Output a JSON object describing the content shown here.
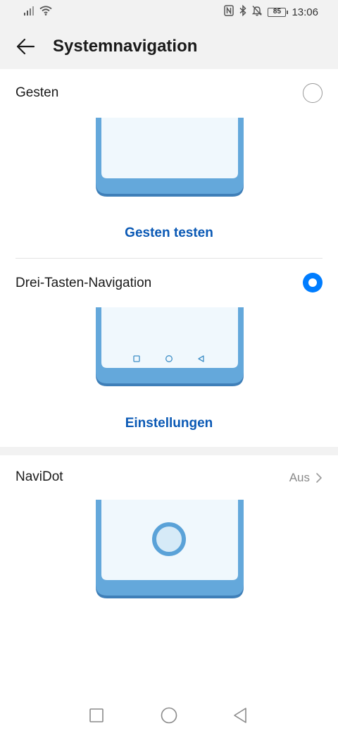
{
  "status_bar": {
    "time": "13:06",
    "battery_level": "85",
    "icons": [
      "signal-icon",
      "wifi-icon",
      "nfc-icon",
      "bluetooth-icon",
      "mute-bell-icon",
      "battery-icon"
    ]
  },
  "header": {
    "title": "Systemnavigation",
    "back_icon": "arrow-left-icon"
  },
  "options": {
    "gestures": {
      "label": "Gesten",
      "selected": false,
      "action_label": "Gesten testen"
    },
    "three_keys": {
      "label": "Drei-Tasten-Navigation",
      "selected": true,
      "action_label": "Einstellungen"
    },
    "navidot": {
      "label": "NaviDot",
      "value": "Aus"
    }
  },
  "colors": {
    "accent": "#007dff",
    "link": "#0a59b5",
    "illustration_blue": "#64a8db",
    "illustration_dark": "#3f7fb8",
    "illustration_screen": "#f0f8fd"
  },
  "navigation_bar": {
    "icons": [
      "recent-apps-icon",
      "home-icon",
      "back-triangle-icon"
    ]
  }
}
